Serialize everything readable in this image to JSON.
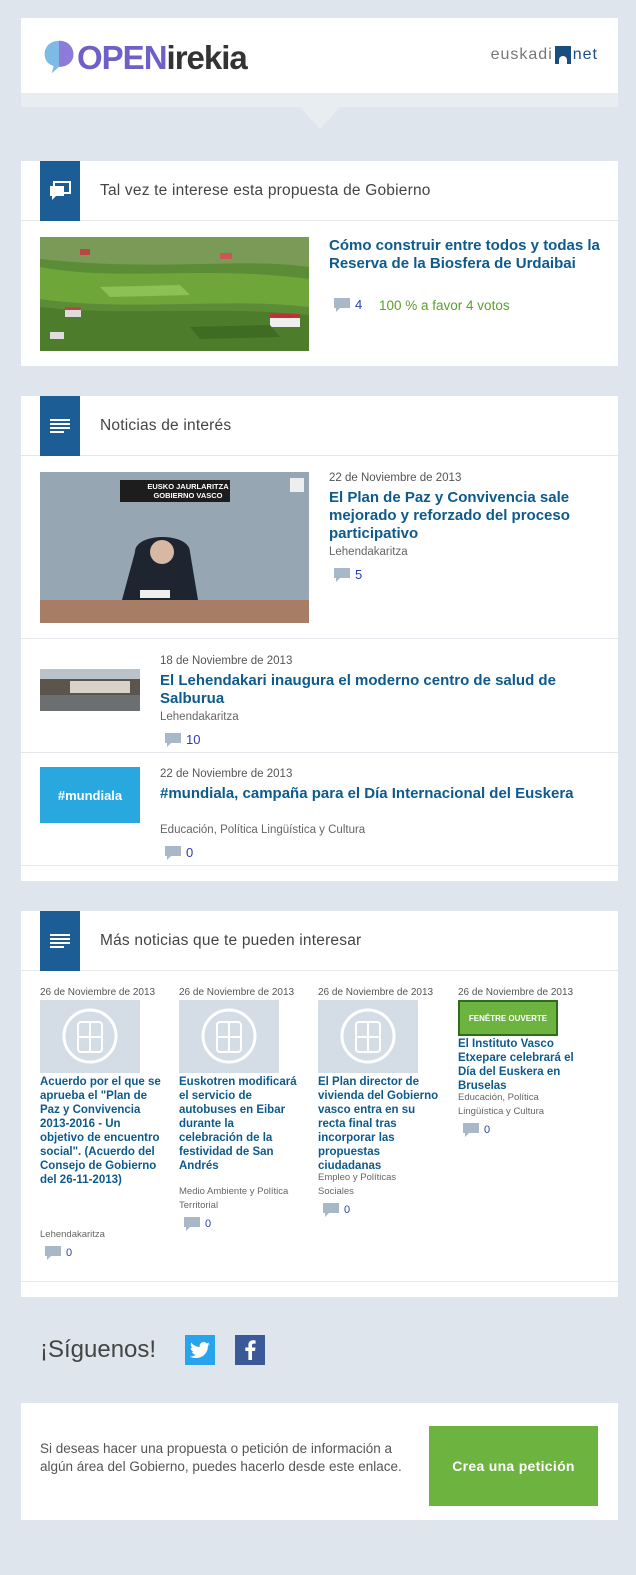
{
  "brand": {
    "logo_open": "OPEN",
    "logo_irekia": "irekia",
    "partner_pre": "euskadi",
    "partner_post": "net"
  },
  "proposal_section": {
    "title": "Tal vez te interese esta propuesta de Gobierno",
    "item": {
      "title": "Cómo construir entre todos y todas la Reserva de la Biosfera de Urdaibai",
      "comments": "4",
      "votes": "100 % a favor 4 votos"
    }
  },
  "news_section": {
    "title": "Noticias de interés",
    "items": [
      {
        "date": "22 de Noviembre de 2013",
        "title": "El Plan de Paz y Convivencia sale mejorado y reforzado del proceso participativo",
        "category": "Lehendakaritza",
        "comments": "5",
        "sign_line1": "EUSKO JAURLARITZA",
        "sign_line2": "GOBIERNO VASCO"
      },
      {
        "date": "18 de Noviembre de 2013",
        "title": "El Lehendakari inaugura el moderno centro de salud de Salburua",
        "category": "Lehendakaritza",
        "comments": "10"
      },
      {
        "date": "22 de Noviembre de 2013",
        "title": "#mundiala, campaña para el Día Internacional del Euskera",
        "category": "Educación, Política Lingüística y Cultura",
        "comments": "0",
        "thumb_text": "#mundiala"
      }
    ]
  },
  "more_section": {
    "title": "Más noticias que te pueden interesar",
    "items": [
      {
        "date": "26 de Noviembre de 2013",
        "title": "Acuerdo por el que se aprueba el \"Plan de Paz y Convivencia 2013-2016 - Un objetivo de encuentro social\". (Acuerdo del Consejo de Gobierno del 26-11-2013)",
        "category": "Lehendakaritza",
        "comments": "0"
      },
      {
        "date": "26 de Noviembre de 2013",
        "title": "Euskotren modificará el servicio de autobuses en Eibar durante la celebración de la festividad de San Andrés",
        "category": "Medio Ambiente y Política Territorial",
        "comments": "0"
      },
      {
        "date": "26 de Noviembre de 2013",
        "title": "El Plan director de vivienda del Gobierno vasco entra en su recta final tras incorporar las propuestas ciudadanas",
        "category": "Empleo y Políticas Sociales",
        "comments": "0"
      },
      {
        "date": "26 de Noviembre de 2013",
        "title": "El Instituto Vasco Etxepare celebrará el Día del Euskera en Bruselas",
        "category": "Educación, Política Lingüística y Cultura",
        "comments": "0",
        "thumb_text": "FENÊTRE OUVERTE"
      }
    ]
  },
  "follow": {
    "label": "¡Síguenos!",
    "twitter_icon": "twitter-icon",
    "facebook_icon": "facebook-icon"
  },
  "footer": {
    "text": "Si deseas hacer una propuesta o petición de información a algún área del Gobierno, puedes hacerlo desde este enlace.",
    "cta": "Crea una petición"
  },
  "colors": {
    "accent": "#1c5d96",
    "link": "#0d5a8c",
    "cta": "#6cb33f",
    "vote": "#5aa02c",
    "twitter": "#2aa3ef",
    "facebook": "#3b5998"
  }
}
